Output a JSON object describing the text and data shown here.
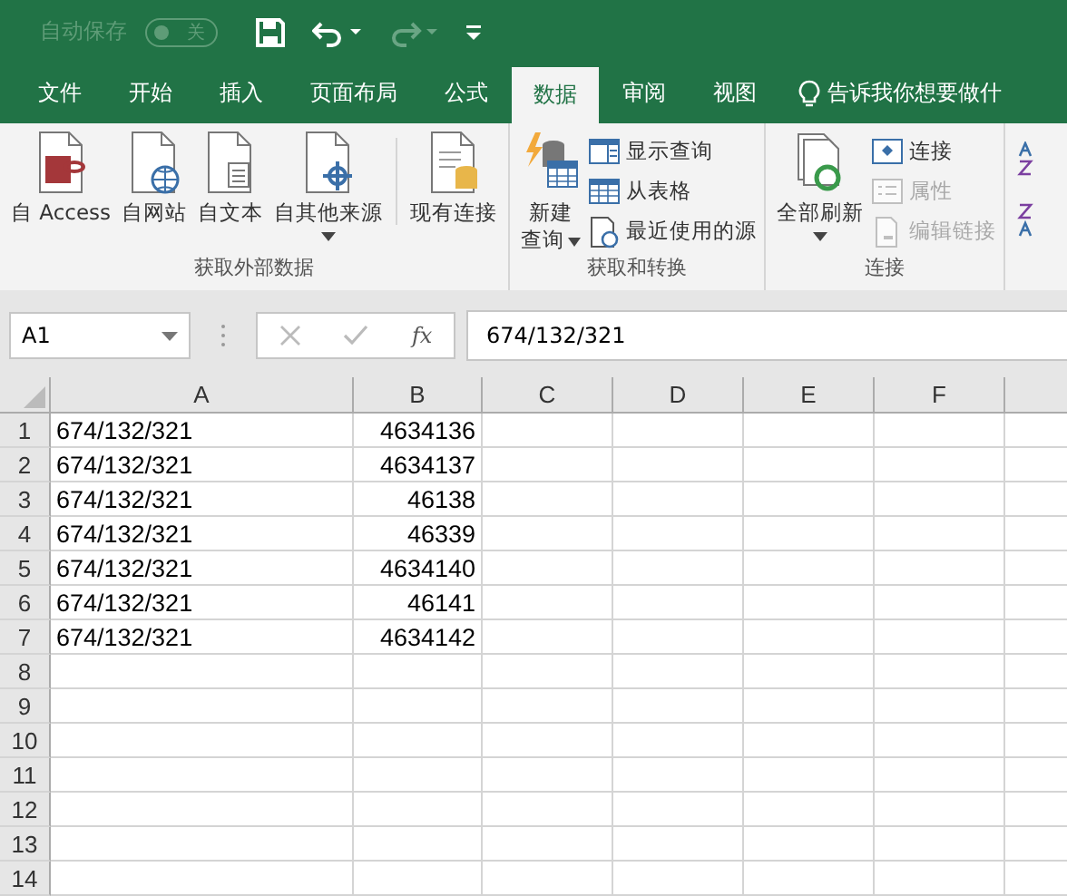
{
  "title_bar": {
    "autosave_label": "自动保存",
    "autosave_toggle": {
      "on": false,
      "label": "关"
    }
  },
  "tabs": [
    {
      "label": "文件",
      "selected": false
    },
    {
      "label": "开始",
      "selected": false
    },
    {
      "label": "插入",
      "selected": false
    },
    {
      "label": "页面布局",
      "selected": false
    },
    {
      "label": "公式",
      "selected": false
    },
    {
      "label": "数据",
      "selected": true
    },
    {
      "label": "审阅",
      "selected": false
    },
    {
      "label": "视图",
      "selected": false
    }
  ],
  "tell_me": "告诉我你想要做什",
  "ribbon": {
    "groups": [
      {
        "label": "获取外部数据",
        "items": [
          {
            "kind": "large",
            "label": "自 Access",
            "dropdown": false
          },
          {
            "kind": "large",
            "label": "自网站",
            "dropdown": false
          },
          {
            "kind": "large",
            "label": "自文本",
            "dropdown": false
          },
          {
            "kind": "large",
            "label": "自其他来源",
            "dropdown": true
          },
          {
            "kind": "separator"
          },
          {
            "kind": "large",
            "label": "现有连接",
            "dropdown": false
          }
        ]
      },
      {
        "label": "获取和转换",
        "items": [
          {
            "kind": "query",
            "label": "新建",
            "label2": "查询",
            "dropdown": true
          },
          {
            "kind": "small",
            "label": "显示查询",
            "disabled": false
          },
          {
            "kind": "small",
            "label": "从表格",
            "disabled": false
          },
          {
            "kind": "small",
            "label": "最近使用的源",
            "disabled": false
          }
        ]
      },
      {
        "label": "连接",
        "items": [
          {
            "kind": "large",
            "label": "全部刷新",
            "dropdown": true
          },
          {
            "kind": "small",
            "label": "连接",
            "disabled": false
          },
          {
            "kind": "small",
            "label": "属性",
            "disabled": true
          },
          {
            "kind": "small",
            "label": "编辑链接",
            "disabled": true
          }
        ]
      }
    ]
  },
  "formula_bar": {
    "name_box": "A1",
    "fx": "fx",
    "formula": "674/132/321"
  },
  "sheet": {
    "columns": [
      "A",
      "B",
      "C",
      "D",
      "E",
      "F"
    ],
    "rows": [
      {
        "number": "1",
        "cells": [
          "674/132/321",
          "4634136"
        ]
      },
      {
        "number": "2",
        "cells": [
          "674/132/321",
          "4634137"
        ]
      },
      {
        "number": "3",
        "cells": [
          "674/132/321",
          "46138"
        ]
      },
      {
        "number": "4",
        "cells": [
          "674/132/321",
          "46339"
        ]
      },
      {
        "number": "5",
        "cells": [
          "674/132/321",
          "4634140"
        ]
      },
      {
        "number": "6",
        "cells": [
          "674/132/321",
          "46141"
        ]
      },
      {
        "number": "7",
        "cells": [
          "674/132/321",
          "4634142"
        ]
      },
      {
        "number": "8",
        "cells": []
      },
      {
        "number": "9",
        "cells": []
      },
      {
        "number": "10",
        "cells": []
      },
      {
        "number": "11",
        "cells": []
      },
      {
        "number": "12",
        "cells": []
      },
      {
        "number": "13",
        "cells": []
      },
      {
        "number": "14",
        "cells": []
      }
    ]
  }
}
